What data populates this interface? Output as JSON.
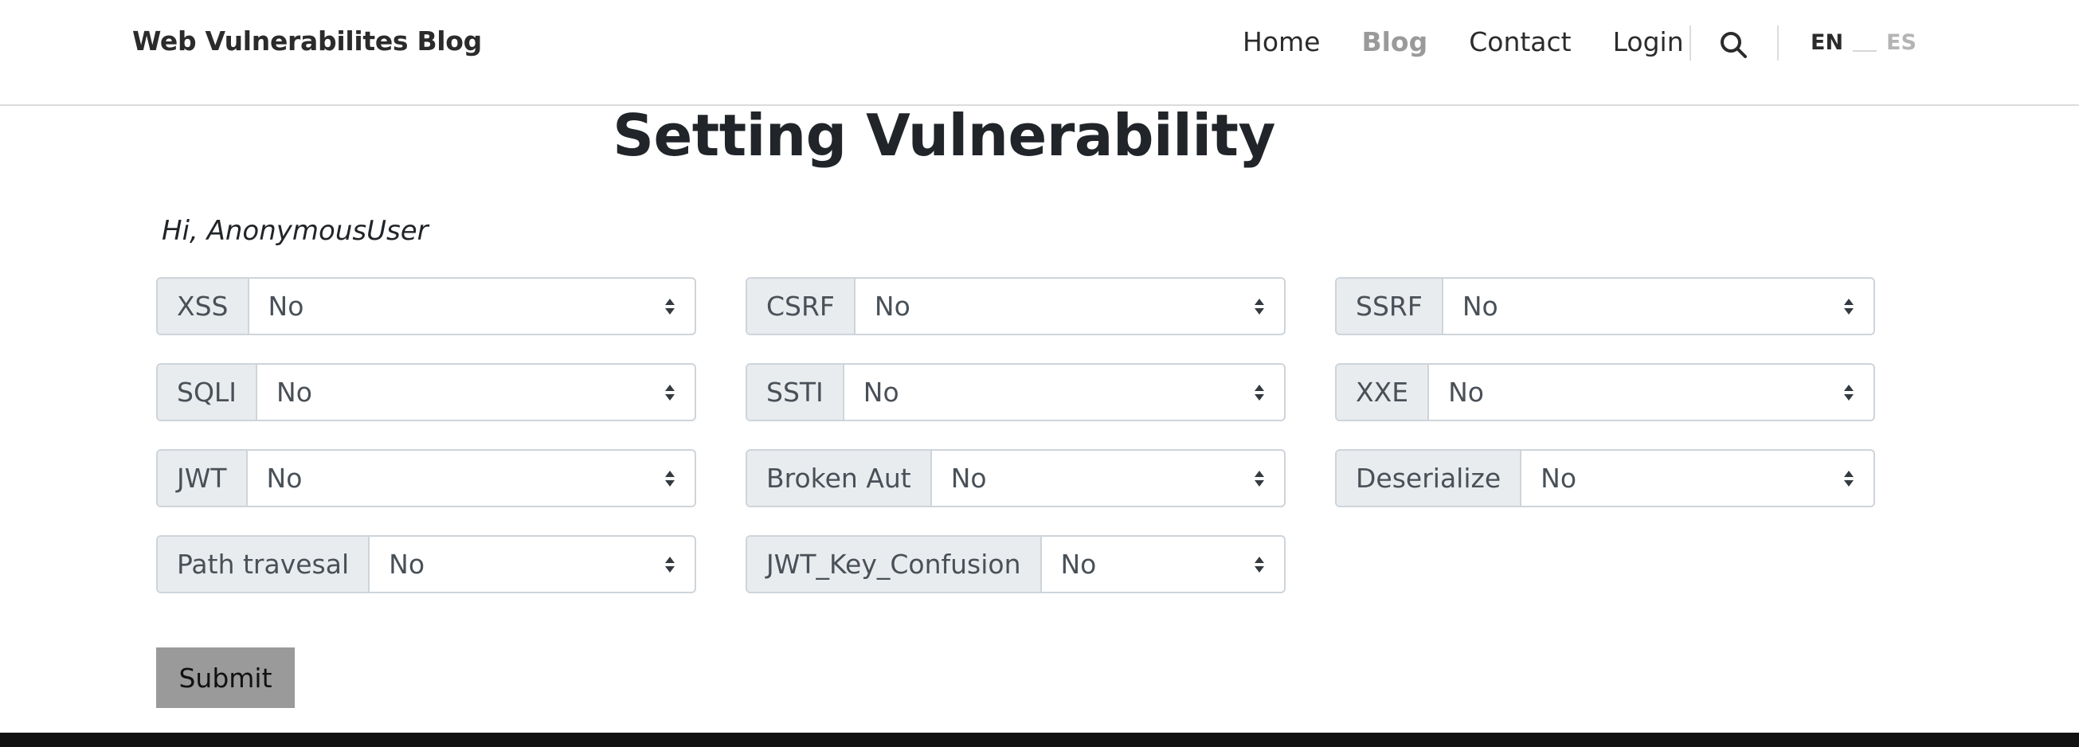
{
  "header": {
    "brand": "Web Vulnerabilites Blog",
    "nav": [
      "Home",
      "Blog",
      "Contact",
      "Login"
    ],
    "active_nav": "Blog",
    "lang_en": "EN",
    "lang_es": "ES"
  },
  "main": {
    "title": "Setting Vulnerability",
    "greeting": "Hi, AnonymousUser",
    "fields": [
      {
        "label": "XSS",
        "value": "No"
      },
      {
        "label": "CSRF",
        "value": "No"
      },
      {
        "label": "SSRF",
        "value": "No"
      },
      {
        "label": "SQLI",
        "value": "No"
      },
      {
        "label": "SSTI",
        "value": "No"
      },
      {
        "label": "XXE",
        "value": "No"
      },
      {
        "label": "JWT",
        "value": "No"
      },
      {
        "label": "Broken Aut",
        "value": "No"
      },
      {
        "label": "Deserialize",
        "value": "No"
      },
      {
        "label": "Path travesal",
        "value": "No"
      },
      {
        "label": "JWT_Key_Confusion",
        "value": "No"
      }
    ],
    "submit_label": "Submit"
  },
  "colors": {
    "accent_gray": "#9a9a9a",
    "footer": "#111111",
    "addon_bg": "#e9ecef",
    "border": "#ced4da"
  }
}
